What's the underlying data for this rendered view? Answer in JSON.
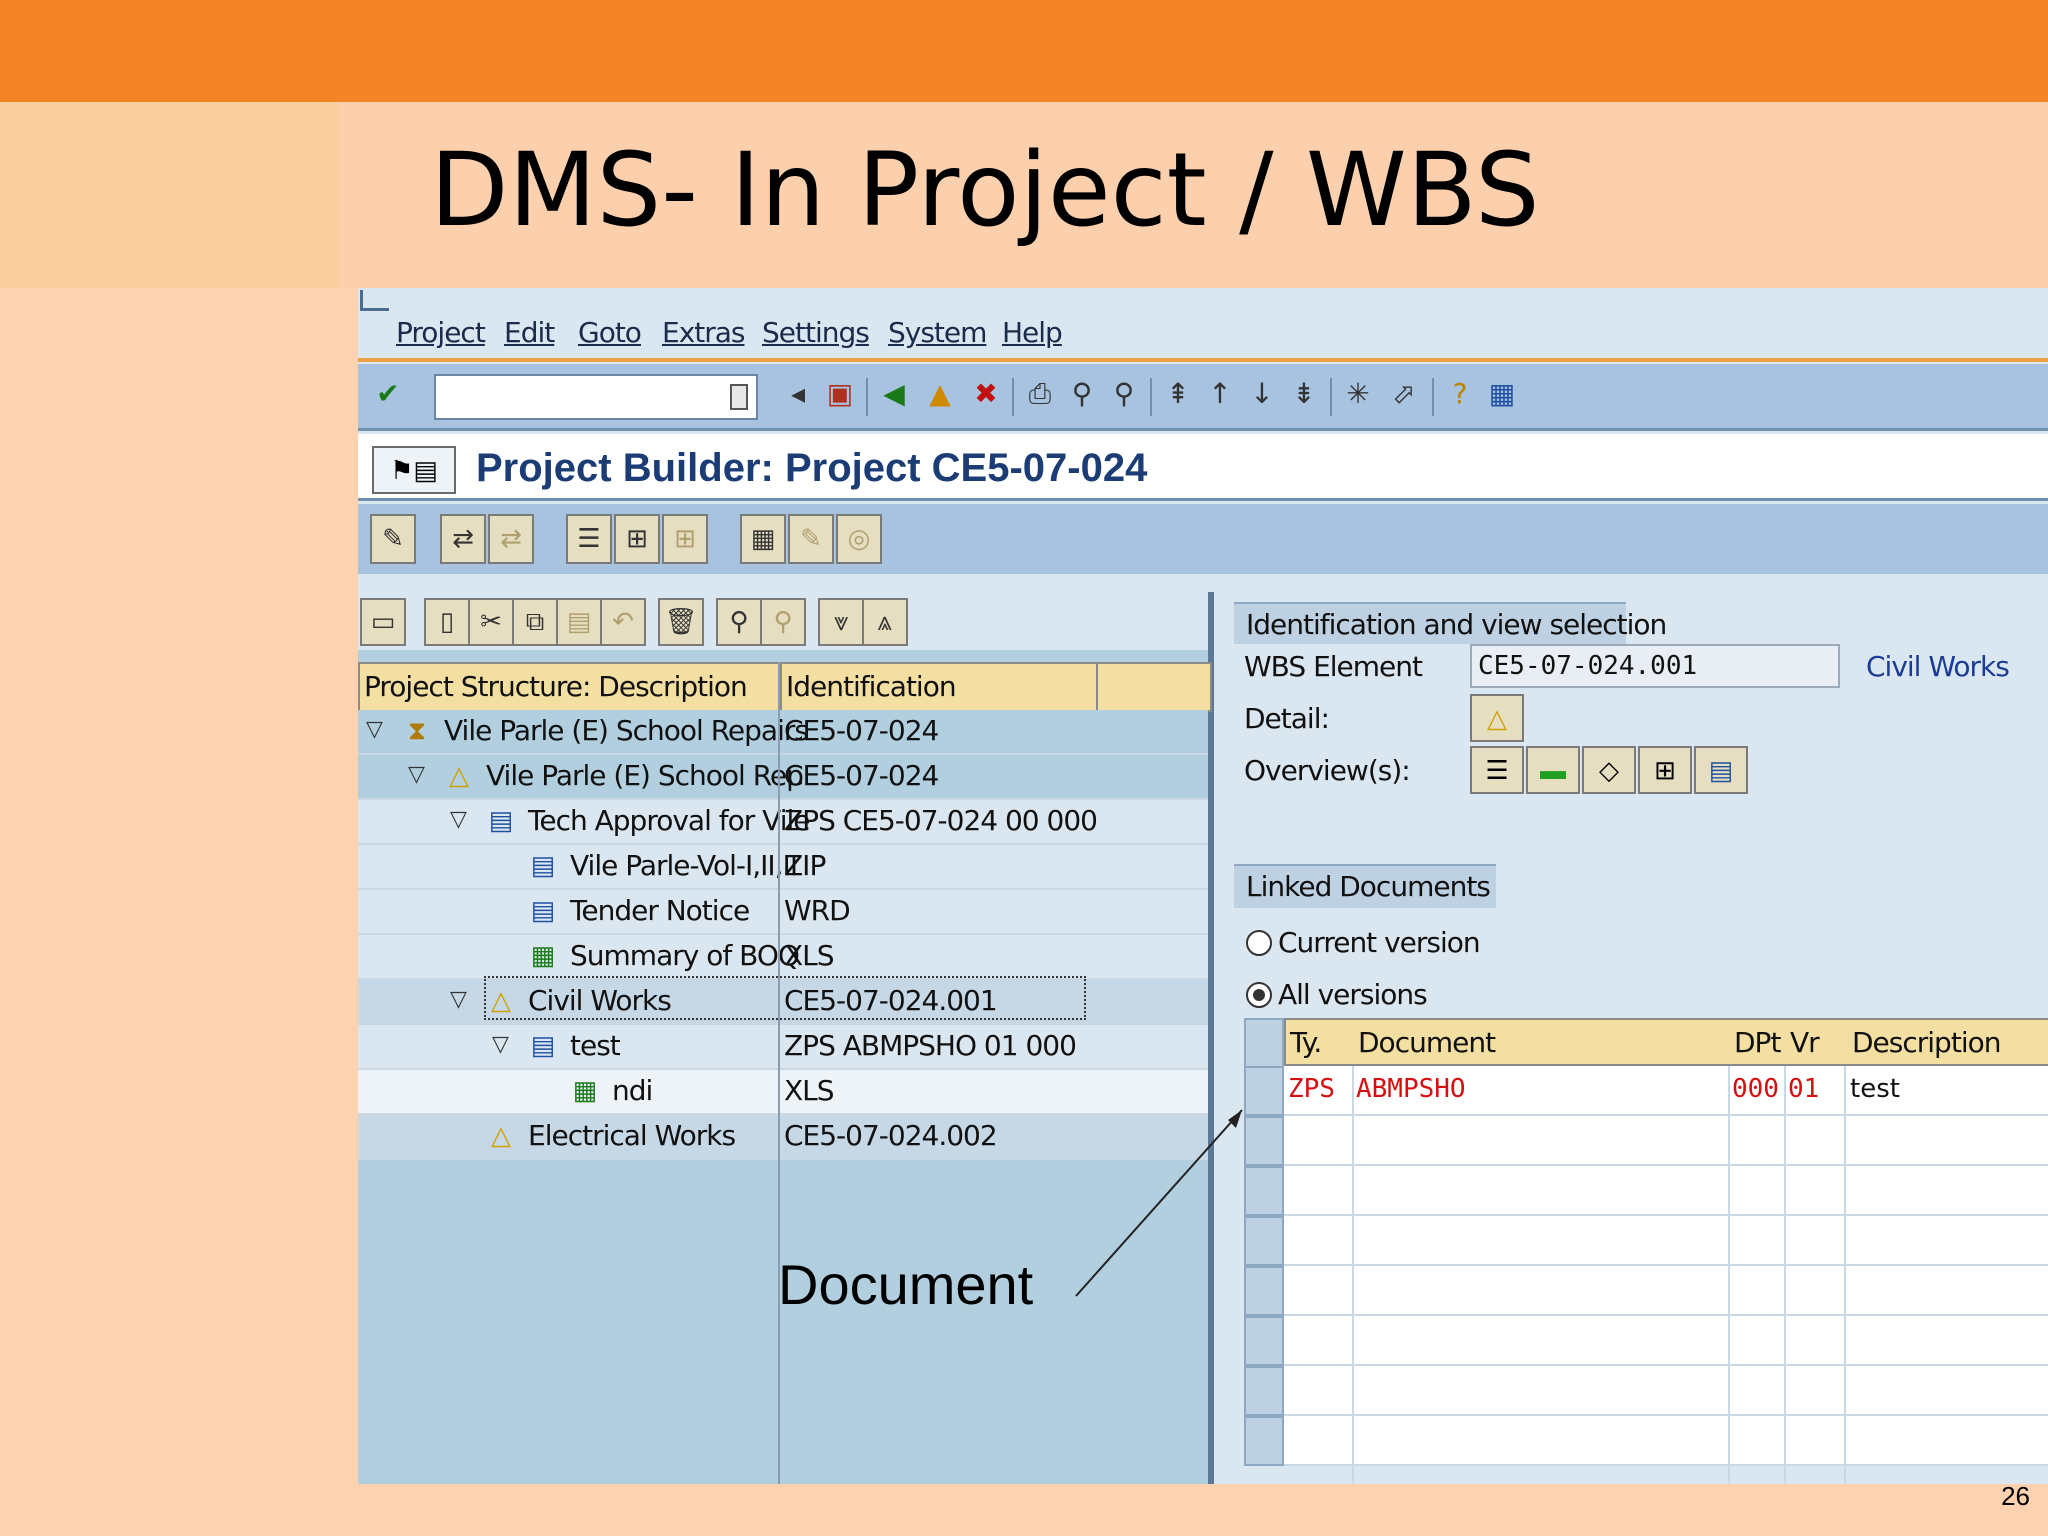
{
  "slide": {
    "title": "DMS- In Project / WBS",
    "page_number": "26",
    "callout": "Document"
  },
  "menu": [
    "Project",
    "Edit",
    "Goto",
    "Extras",
    "Settings",
    "System",
    "Help"
  ],
  "header": {
    "title": "Project Builder: Project CE5-07-024"
  },
  "structure": {
    "columns": [
      "Project Structure: Description",
      "Identification"
    ],
    "rows": [
      {
        "desc": "Vile Parle (E) School Repairs",
        "ident": "CE5-07-024",
        "icon": "hourglass-icon"
      },
      {
        "desc": "Vile Parle (E) School Rep",
        "ident": "CE5-07-024",
        "icon": "wbs-triangle-icon"
      },
      {
        "desc": "Tech Approval for Vile",
        "ident": "ZPS CE5-07-024 00 000",
        "icon": "document-icon"
      },
      {
        "desc": "Vile Parle-Vol-I,II,II",
        "ident": "ZIP",
        "icon": "document-icon"
      },
      {
        "desc": "Tender Notice",
        "ident": "WRD",
        "icon": "document-icon"
      },
      {
        "desc": "Summary of BOQ",
        "ident": "XLS",
        "icon": "spreadsheet-icon"
      },
      {
        "desc": "Civil Works",
        "ident": "CE5-07-024.001",
        "icon": "wbs-triangle-icon"
      },
      {
        "desc": "test",
        "ident": "ZPS ABMPSHO 01 000",
        "icon": "document-icon"
      },
      {
        "desc": "ndi",
        "ident": "XLS",
        "icon": "spreadsheet-icon"
      },
      {
        "desc": "Electrical Works",
        "ident": "CE5-07-024.002",
        "icon": "wbs-triangle-icon"
      }
    ]
  },
  "identification": {
    "tab_label": "Identification and view selection",
    "wbs_label": "WBS Element",
    "wbs_value": "CE5-07-024.001",
    "wbs_desc": "Civil Works",
    "detail_label": "Detail:",
    "overview_label": "Overview(s):"
  },
  "linked_docs": {
    "tab_label": "Linked Documents",
    "radio_current": "Current version",
    "radio_all": "All versions",
    "selected": "All versions",
    "columns": [
      "Ty.",
      "Document",
      "DPt",
      "Vr",
      "Description"
    ],
    "rows": [
      {
        "type": "ZPS",
        "document": "ABMPSHO",
        "dpt": "000",
        "vr": "01",
        "description": "test"
      }
    ]
  },
  "colors": {
    "top_bar": "#f48426",
    "doc_row_text": "#d41010",
    "title_blue": "#1b3c74"
  }
}
